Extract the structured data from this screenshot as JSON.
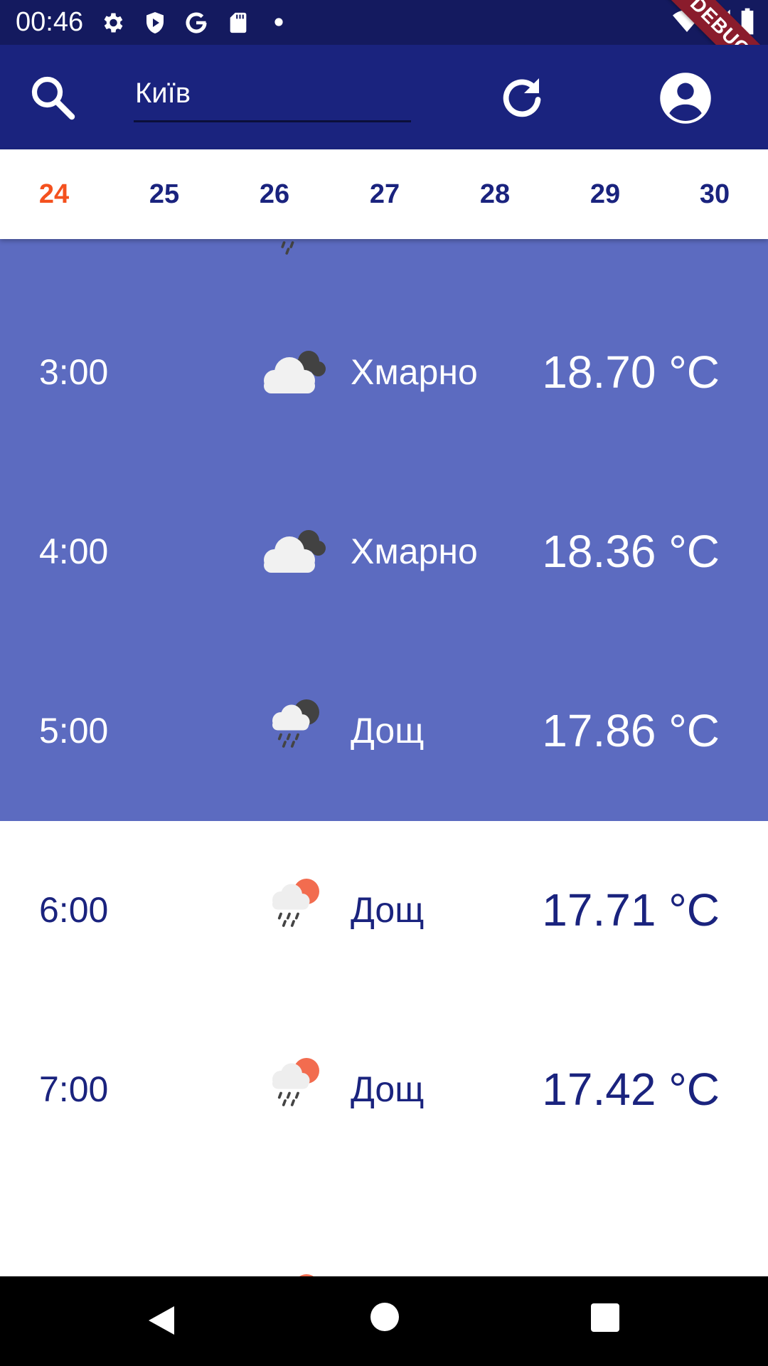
{
  "status_bar": {
    "time": "00:46",
    "debug_label": "DEBUG",
    "icons": [
      "settings-icon",
      "shield-icon",
      "google-icon",
      "sd-card-icon",
      "dot-icon",
      "wifi-icon",
      "signal-icon",
      "battery-icon"
    ]
  },
  "app_bar": {
    "city_value": "Київ",
    "icons": [
      "search-icon",
      "refresh-icon",
      "account-circle-icon"
    ],
    "background": "#1a237e"
  },
  "day_tabs": {
    "items": [
      "24",
      "25",
      "26",
      "27",
      "28",
      "29",
      "30"
    ],
    "active": "24",
    "active_color": "#f4511e",
    "color": "#1a237e"
  },
  "forecast": {
    "rows": [
      {
        "hour": "3:00",
        "desc": "Хмарно",
        "temp": "18.70 °C",
        "icon": "cloudy-night-icon"
      },
      {
        "hour": "4:00",
        "desc": "Хмарно",
        "temp": "18.36 °C",
        "icon": "cloudy-night-icon"
      },
      {
        "hour": "5:00",
        "desc": "Дощ",
        "temp": "17.86 °C",
        "icon": "rain-night-icon"
      },
      {
        "hour": "6:00",
        "desc": "Дощ",
        "temp": "17.71 °C",
        "icon": "rain-day-icon"
      },
      {
        "hour": "7:00",
        "desc": "Дощ",
        "temp": "17.42 °C",
        "icon": "rain-day-icon"
      }
    ],
    "past_background": "#5c6bc0",
    "future_background": "#ffffff"
  },
  "nav_bar": {
    "icons": [
      "back-icon",
      "home-icon",
      "recents-icon"
    ]
  }
}
